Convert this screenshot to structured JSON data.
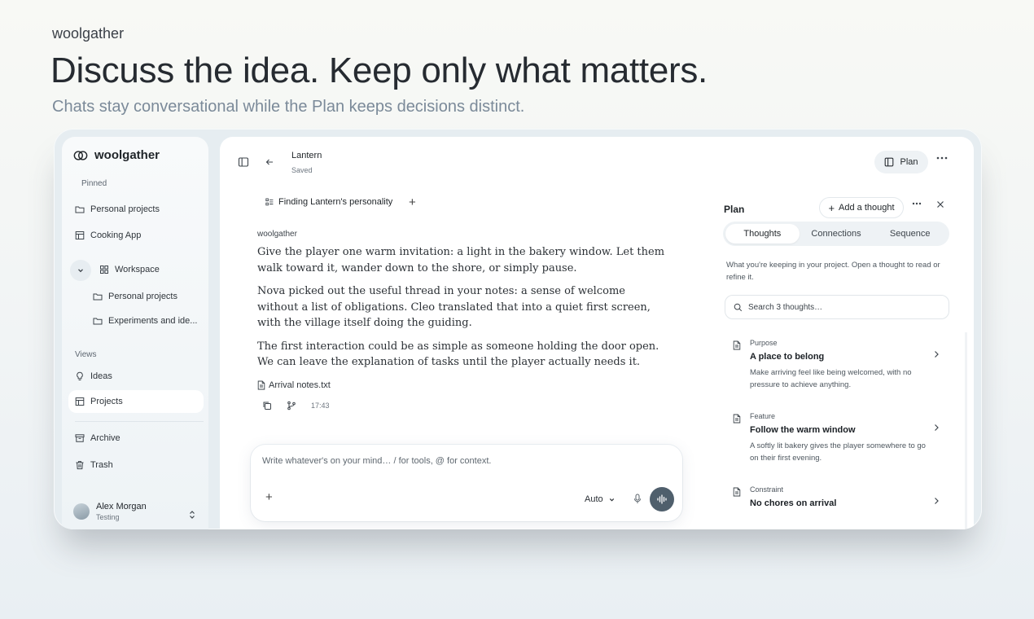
{
  "hero": {
    "brand": "woolgather",
    "title": "Discuss the idea. Keep only what matters.",
    "subtitle": "Chats stay conversational while the Plan keeps decisions distinct."
  },
  "sidebar": {
    "app_name": "woolgather",
    "pinned_label": "Pinned",
    "pinned": [
      {
        "label": "Personal projects",
        "icon": "folder-icon"
      },
      {
        "label": "Cooking App",
        "icon": "board-icon"
      }
    ],
    "workspace": {
      "label": "Workspace",
      "children": [
        "Personal projects",
        "Experiments and ide..."
      ]
    },
    "views_label": "Views",
    "views": [
      {
        "label": "Ideas",
        "icon": "lightbulb-icon"
      },
      {
        "label": "Projects",
        "icon": "board-icon"
      }
    ],
    "bottom": [
      {
        "label": "Archive",
        "icon": "archive-icon"
      },
      {
        "label": "Trash",
        "icon": "trash-icon"
      }
    ],
    "user": {
      "name": "Alex Morgan",
      "subtitle": "Testing"
    }
  },
  "header": {
    "title": "Lantern",
    "status": "Saved",
    "plan_label": "Plan"
  },
  "chat": {
    "tab_label": "Finding Lantern's personality",
    "author": "woolgather",
    "paragraphs": [
      "Give the player one warm invitation: a light in the bakery window. Let them walk toward it, wander down to the shore, or simply pause.",
      "Nova picked out the useful thread in your notes: a sense of welcome without a list of obligations. Cleo translated that into a quiet first screen, with the village itself doing the guiding.",
      "The first interaction could be as simple as someone holding the door open. We can leave the explanation of tasks until the player actually needs it."
    ],
    "attachment": "Arrival notes.txt",
    "time": "17:43"
  },
  "composer": {
    "placeholder": "Write whatever's on your mind… / for tools, @ for context.",
    "mode": "Auto"
  },
  "plan": {
    "title": "Plan",
    "add_label": "Add a thought",
    "tabs": [
      "Thoughts",
      "Connections",
      "Sequence"
    ],
    "active_tab": "Thoughts",
    "description": "What you're keeping in your project. Open a thought to read or refine it.",
    "search_placeholder": "Search 3 thoughts…",
    "thoughts": [
      {
        "kind": "Purpose",
        "title": "A place to belong",
        "desc": "Make arriving feel like being welcomed, with no pressure to achieve anything."
      },
      {
        "kind": "Feature",
        "title": "Follow the warm window",
        "desc": "A softly lit bakery gives the player somewhere to go on their first evening."
      },
      {
        "kind": "Constraint",
        "title": "No chores on arrival",
        "desc": ""
      }
    ]
  },
  "colors": {
    "send_button": "#4f5f6c",
    "accent_bg": "#eef2f5"
  }
}
